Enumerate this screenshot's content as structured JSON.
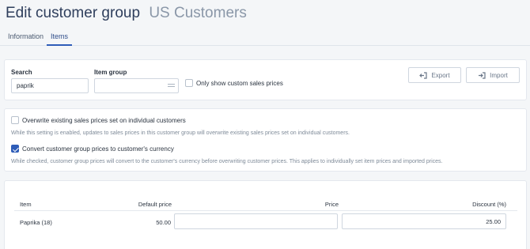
{
  "header": {
    "title": "Edit customer group",
    "subtitle": "US Customers"
  },
  "tabs": [
    {
      "label": "Information",
      "active": false
    },
    {
      "label": "Items",
      "active": true
    }
  ],
  "search_panel": {
    "search_label": "Search",
    "search_value": "paprik",
    "item_group_label": "Item group",
    "item_group_value": "",
    "custom_prices_label": "Only show custom sales prices",
    "custom_prices_checked": false,
    "export_label": "Export",
    "import_label": "Import"
  },
  "settings": {
    "overwrite_label": "Overwrite existing sales prices set on individual customers",
    "overwrite_checked": false,
    "overwrite_help": "While this setting is enabled, updates to sales prices in this customer group will overwrite existing sales prices set on individual customers.",
    "convert_label": "Convert customer group prices to customer's currency",
    "convert_checked": true,
    "convert_help": "While checked, customer group prices will convert to the customer's currency before overwriting customer prices. This applies to individually set item prices and imported prices."
  },
  "table": {
    "columns": {
      "item": "Item",
      "default_price": "Default price",
      "price": "Price",
      "discount": "Discount (%)"
    },
    "rows": [
      {
        "item": "Paprika (18)",
        "default_price": "50.00",
        "price": "",
        "discount": "25.00"
      }
    ]
  },
  "colors": {
    "accent": "#2f5db8",
    "background": "#f4f6f8",
    "card": "#ffffff"
  },
  "icons": {
    "export": "export-arrow-icon",
    "import": "import-arrow-icon",
    "item_group_select": "list-select-icon",
    "checkbox_checked": "checkmark-icon"
  }
}
